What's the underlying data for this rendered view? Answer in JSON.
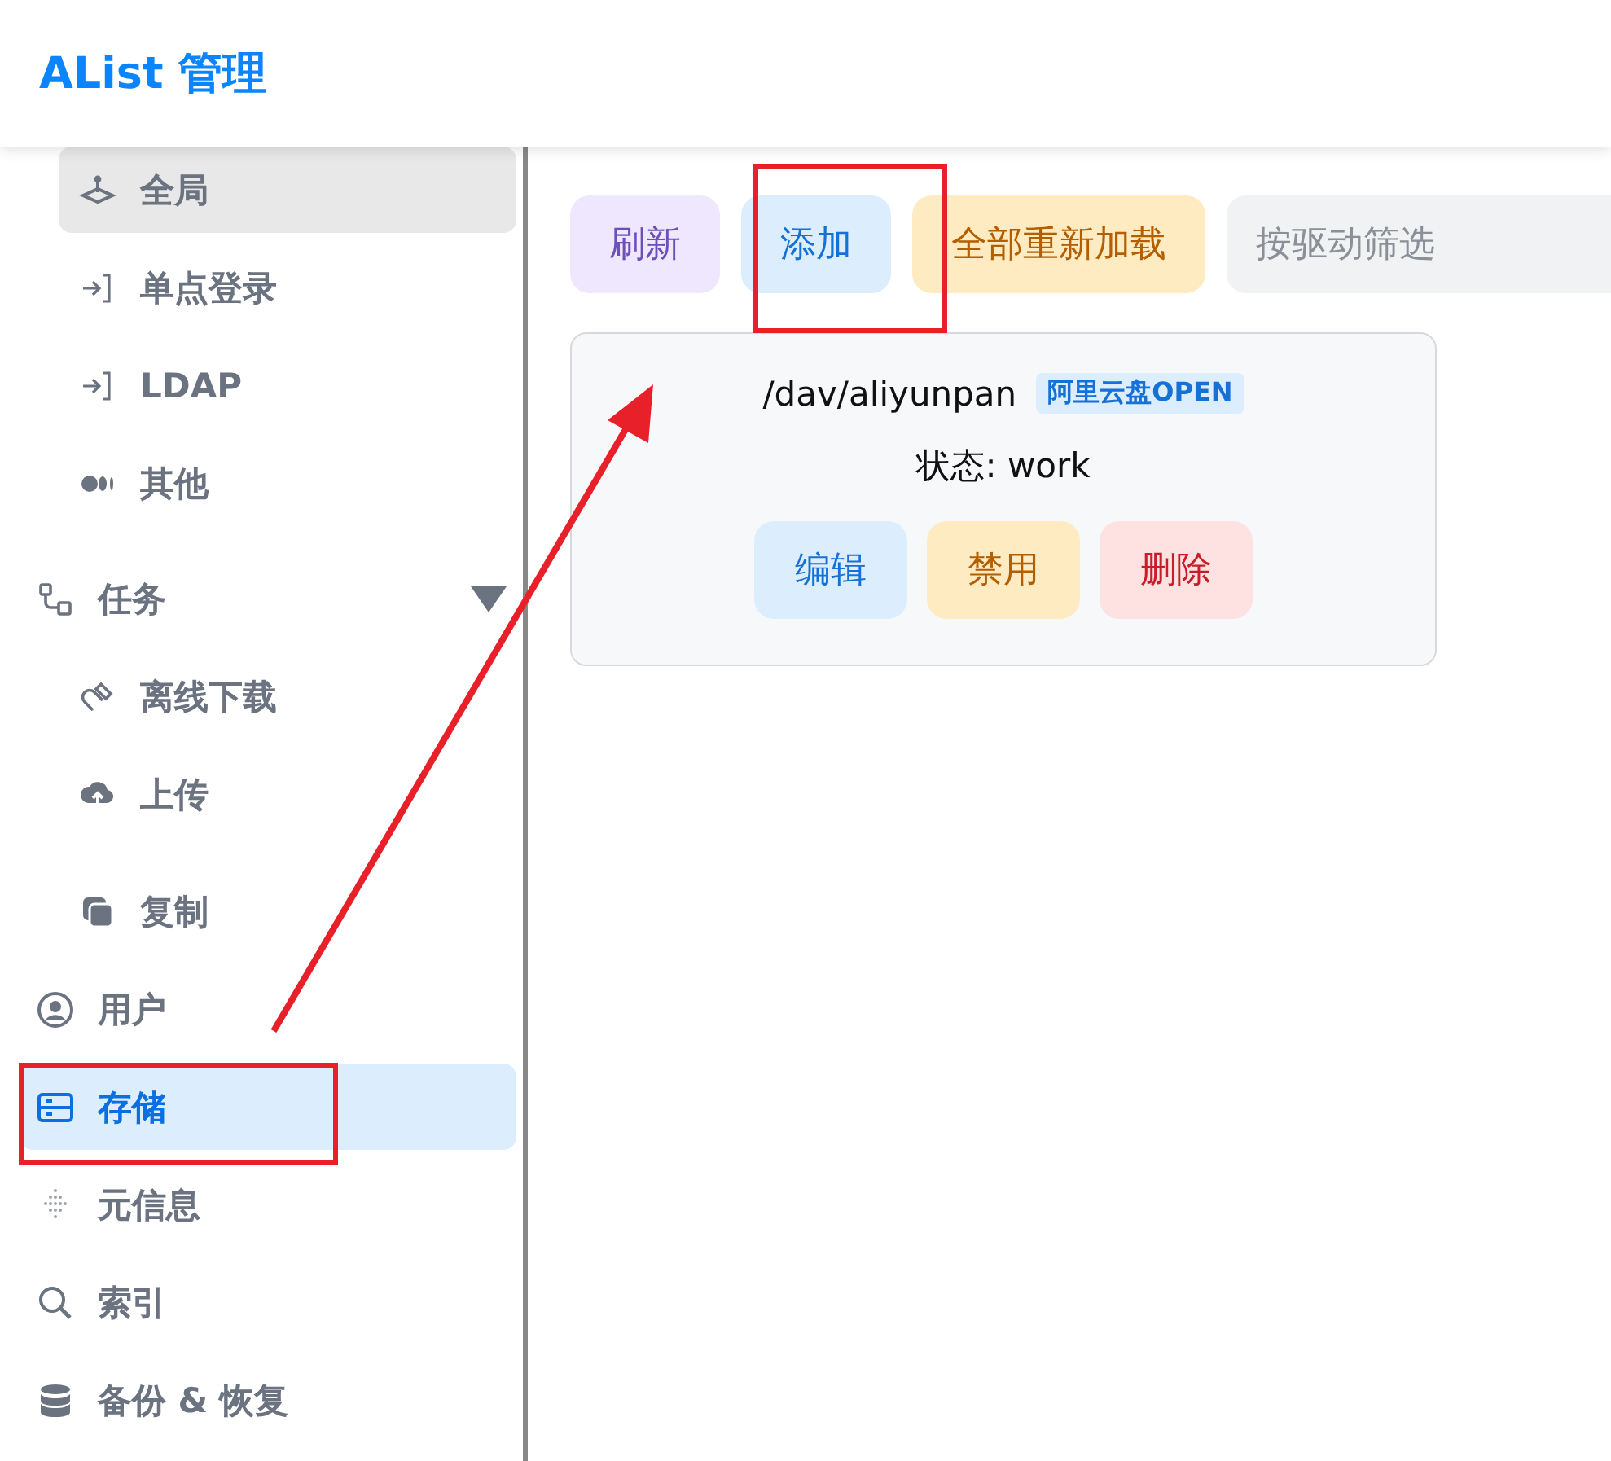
{
  "header": {
    "title": "AList 管理"
  },
  "sidebar": {
    "items": [
      {
        "children": [
          {
            "label": "全局",
            "selected": false,
            "hovered": true
          },
          {
            "label": "单点登录",
            "selected": false,
            "hovered": false
          },
          {
            "label": "LDAP",
            "selected": false,
            "hovered": false
          },
          {
            "label": "其他",
            "selected": false,
            "hovered": false
          }
        ]
      },
      {
        "label": "任务",
        "selected": false,
        "hovered": false,
        "expanded": true,
        "children": [
          {
            "label": "离线下载",
            "selected": false,
            "hovered": false
          },
          {
            "label": "上传",
            "selected": false,
            "hovered": false
          },
          {
            "label": "复制",
            "selected": false,
            "hovered": false
          }
        ]
      },
      {
        "label": "用户",
        "selected": false,
        "hovered": false
      },
      {
        "label": "存储",
        "selected": true,
        "hovered": false
      },
      {
        "label": "元信息",
        "selected": false,
        "hovered": false
      },
      {
        "label": "索引",
        "selected": false,
        "hovered": false
      },
      {
        "label": "备份 & 恢复",
        "selected": false,
        "hovered": false
      }
    ]
  },
  "toolbar": {
    "buttons": [
      {
        "label": "刷新",
        "kind": "accent"
      },
      {
        "label": "添加",
        "kind": "info"
      },
      {
        "label": "全部重新加载",
        "kind": "warning"
      }
    ],
    "filter": {
      "placeholder": "按驱动筛选"
    }
  },
  "storages": [
    {
      "path": "/dav/aliyunpan",
      "driver": "阿里云盘OPEN",
      "status": "状态: work",
      "buttons": [
        {
          "label": "编辑",
          "kind": "info"
        },
        {
          "label": "禁用",
          "kind": "warning"
        },
        {
          "label": "删除",
          "kind": "danger"
        }
      ]
    }
  ]
}
